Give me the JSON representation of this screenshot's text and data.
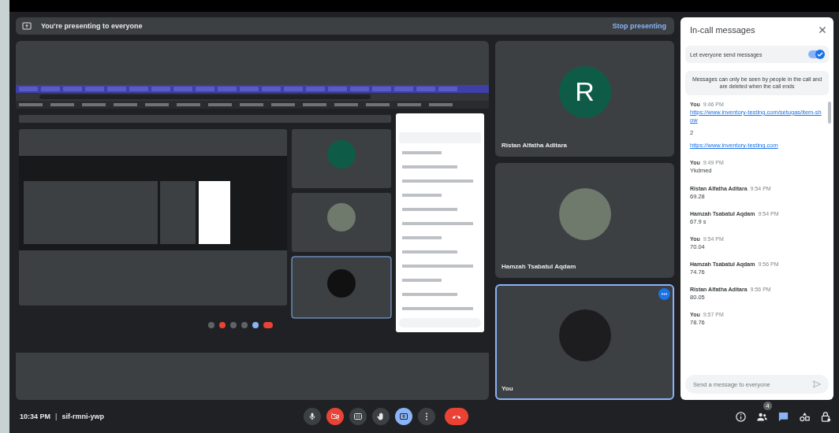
{
  "presenting_bar": {
    "message": "You're presenting to everyone",
    "stop_button": "Stop presenting"
  },
  "participants": [
    {
      "name": "Ristan Alfatha Aditara",
      "kind": "letter",
      "initial": "R",
      "selected": false,
      "menu": false
    },
    {
      "name": "Hamzah Tsabatul Aqdam",
      "kind": "photo",
      "selected": false,
      "menu": false
    },
    {
      "name": "You",
      "kind": "photo",
      "selected": true,
      "menu": true
    }
  ],
  "chat": {
    "title": "In-call messages",
    "toggle": {
      "label": "Let everyone send messages",
      "on": true
    },
    "notice": "Messages can only be seen by people in the call and are deleted when the call ends",
    "messages": [
      {
        "sender": "You",
        "time": "9:46 PM",
        "lines": [
          {
            "kind": "link",
            "text": "https://www.inventory-testing.com/setugas/item-show"
          },
          {
            "kind": "text",
            "text": "2"
          },
          {
            "kind": "link",
            "text": "https://www.inventory-testing.com"
          }
        ]
      },
      {
        "sender": "You",
        "time": "9:49 PM",
        "lines": [
          {
            "kind": "text",
            "text": "Ykdmed"
          }
        ]
      },
      {
        "sender": "Ristan Alfatha Aditara",
        "time": "9:54 PM",
        "lines": [
          {
            "kind": "text",
            "text": "69.28"
          }
        ]
      },
      {
        "sender": "Hamzah Tsabatul Aqdam",
        "time": "9:54 PM",
        "lines": [
          {
            "kind": "text",
            "text": "67.9 s"
          }
        ]
      },
      {
        "sender": "You",
        "time": "9:54 PM",
        "lines": [
          {
            "kind": "text",
            "text": "70.04"
          }
        ]
      },
      {
        "sender": "Hamzah Tsabatul Aqdam",
        "time": "9:56 PM",
        "lines": [
          {
            "kind": "text",
            "text": "74.76"
          }
        ]
      },
      {
        "sender": "Ristan Alfatha Aditara",
        "time": "9:56 PM",
        "lines": [
          {
            "kind": "text",
            "text": "80.05"
          }
        ]
      },
      {
        "sender": "You",
        "time": "9:57 PM",
        "lines": [
          {
            "kind": "text",
            "text": "78.76"
          }
        ]
      }
    ],
    "input": {
      "placeholder": "Send a message to everyone"
    }
  },
  "bottom_bar": {
    "time": "10:34 PM",
    "separator": "|",
    "meeting_code": "sif-rmni-ywp",
    "controls": [
      {
        "kind": "mic",
        "on": true
      },
      {
        "kind": "camera",
        "on": false
      },
      {
        "kind": "captions",
        "on": false
      },
      {
        "kind": "hand",
        "on": false
      },
      {
        "kind": "present",
        "on": true
      },
      {
        "kind": "more"
      },
      {
        "kind": "leave"
      }
    ],
    "side_controls": [
      {
        "kind": "info",
        "on": false
      },
      {
        "kind": "people",
        "on": false,
        "badge": "4"
      },
      {
        "kind": "chat",
        "on": true
      },
      {
        "kind": "activities",
        "on": false
      },
      {
        "kind": "host",
        "on": false
      }
    ]
  }
}
